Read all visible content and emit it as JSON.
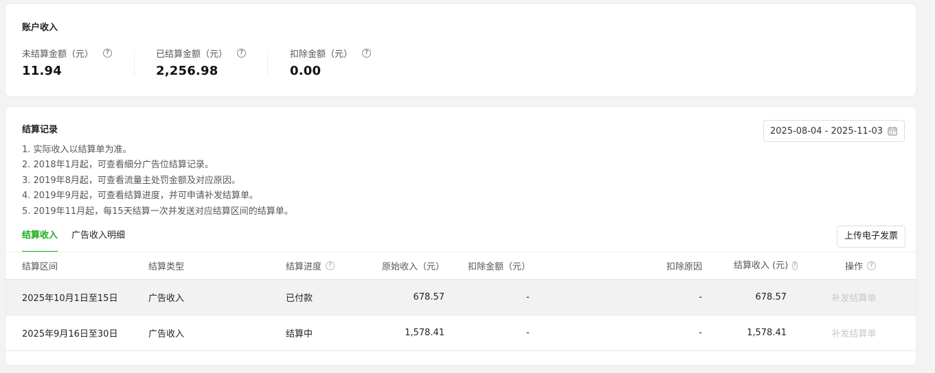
{
  "income": {
    "title": "账户收入",
    "stats": [
      {
        "label": "未结算金额（元）",
        "value": "11.94"
      },
      {
        "label": "已结算金额（元）",
        "value": "2,256.98"
      },
      {
        "label": "扣除金额（元）",
        "value": "0.00"
      }
    ]
  },
  "settle": {
    "title": "结算记录",
    "date_range": "2025-08-04 - 2025-11-03",
    "notes": [
      "1. 实际收入以结算单为准。",
      "2. 2018年1月起，可查看细分广告位结算记录。",
      "3. 2019年8月起，可查看流量主处罚金额及对应原因。",
      "4. 2019年9月起，可查看结算进度，并可申请补发结算单。",
      "5. 2019年11月起，每15天结算一次并发送对应结算区间的结算单。"
    ],
    "tabs": [
      "结算收入",
      "广告收入明细"
    ],
    "upload_label": "上传电子发票",
    "columns": {
      "period": "结算区间",
      "type": "结算类型",
      "progress": "结算进度",
      "original": "原始收入（元）",
      "deduct": "扣除金额（元）",
      "reason": "扣除原因",
      "settled_1": "结算收入",
      "settled_2": "(元)",
      "action": "操作"
    },
    "rows": [
      {
        "period": "2025年10月1日至15日",
        "type": "广告收入",
        "progress": "已付款",
        "original": "678.57",
        "deduct": "-",
        "reason": "-",
        "settled": "678.57",
        "action": "补发结算单"
      },
      {
        "period": "2025年9月16日至30日",
        "type": "广告收入",
        "progress": "结算中",
        "original": "1,578.41",
        "deduct": "-",
        "reason": "-",
        "settled": "1,578.41",
        "action": "补发结算单"
      }
    ]
  },
  "colors": {
    "accent": "#1aad19",
    "row_highlight": "#f2f2f2"
  },
  "icons": {
    "help": "question-circle-icon",
    "calendar": "calendar-icon"
  }
}
